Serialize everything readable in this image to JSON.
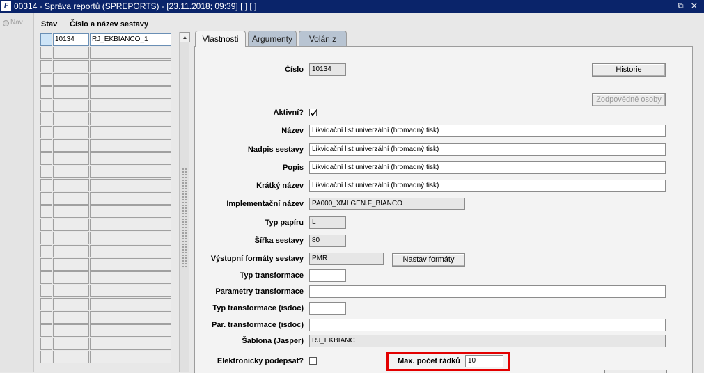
{
  "window": {
    "icon": "F",
    "title": "00314 - Správa reportů (SPREPORTS) - [23.11.2018; 09:39]  [ ]  [ ]",
    "controls": "⧉ ✕"
  },
  "nav": {
    "label": "Nav"
  },
  "list": {
    "headers": {
      "stav": "Stav",
      "name": "Číslo a název sestavy"
    },
    "selected": {
      "number": "10134",
      "name": "RJ_EKBIANCO_1"
    }
  },
  "tabs": [
    {
      "label": "Vlastnosti"
    },
    {
      "label": "Argumenty"
    },
    {
      "label": "Volán z"
    }
  ],
  "form": {
    "cislo": {
      "label": "Číslo",
      "value": "10134"
    },
    "historie_button": "Historie",
    "zodpovedne_button": "Zodpovědné osoby",
    "aktivni": {
      "label": "Aktivní?",
      "checked": true
    },
    "nazev": {
      "label": "Název",
      "value": "Likvidační list univerzální (hromadný tisk)"
    },
    "nadpis": {
      "label": "Nadpis sestavy",
      "value": "Likvidační list univerzální (hromadný tisk)"
    },
    "popis": {
      "label": "Popis",
      "value": "Likvidační list univerzální (hromadný tisk)"
    },
    "kratky": {
      "label": "Krátký název",
      "value": "Likvidační list univerzální (hromadný tisk)"
    },
    "impl": {
      "label": "Implementační název",
      "value": "PA000_XMLGEN.F_BIANCO"
    },
    "typ_papiru": {
      "label": "Typ papíru",
      "value": "L"
    },
    "sirka": {
      "label": "Šířka sestavy",
      "value": "80"
    },
    "vystupni": {
      "label": "Výstupní formáty sestavy",
      "value": "PMR"
    },
    "nastav_button": "Nastav formáty",
    "typ_transf": {
      "label": "Typ transformace",
      "value": ""
    },
    "param_transf": {
      "label": "Parametry transformace",
      "value": ""
    },
    "typ_transf_isdoc": {
      "label": "Typ transformace (isdoc)",
      "value": ""
    },
    "par_transf_isdoc": {
      "label": "Par. transformace (isdoc)",
      "value": ""
    },
    "sablona": {
      "label": "Šablona (Jasper)",
      "value": "RJ_EKBIANC"
    },
    "elektronicky": {
      "label": "Elektronicky podepsat?",
      "checked": false
    },
    "max_pocet": {
      "label": "Max. počet řádků",
      "value": "10"
    }
  },
  "colors": {
    "titlebar": "#0a246a",
    "highlight": "#e30000",
    "tab_inactive": "#b8c4d2"
  }
}
